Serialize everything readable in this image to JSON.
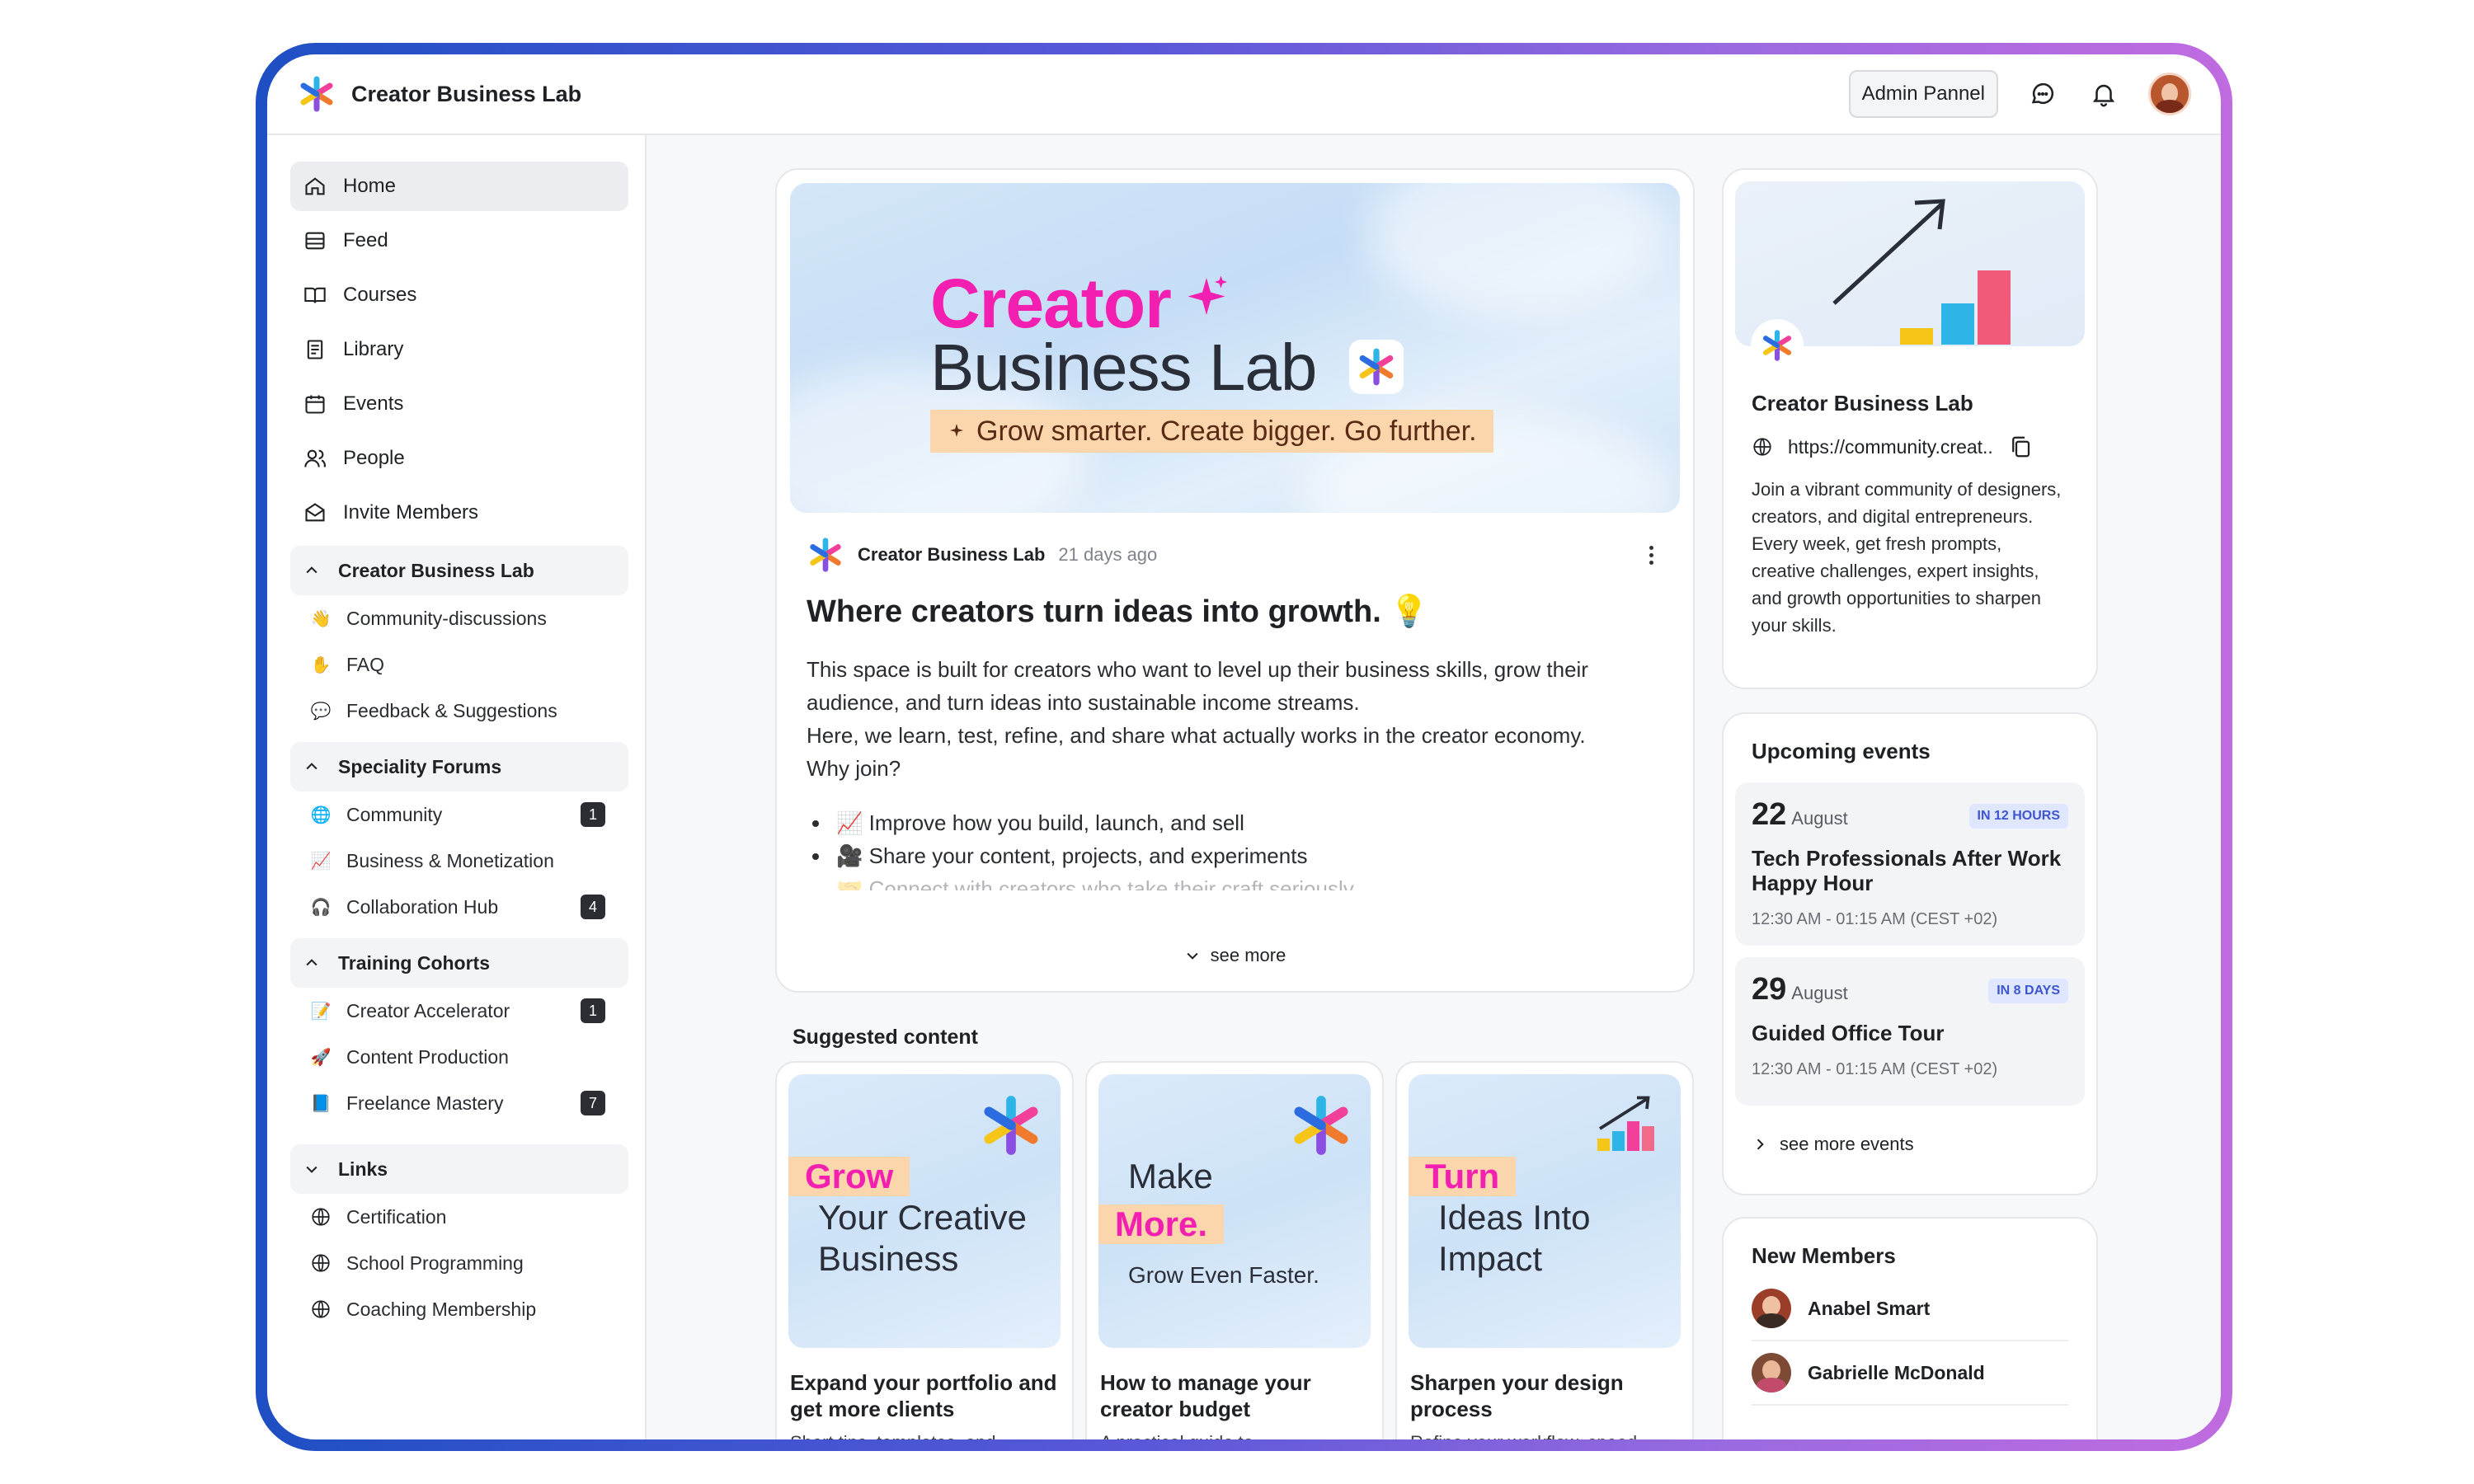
{
  "app": {
    "title": "Creator Business Lab"
  },
  "header": {
    "admin_button": "Admin Pannel"
  },
  "nav": [
    {
      "label": "Home",
      "icon": "home-icon"
    },
    {
      "label": "Feed",
      "icon": "feed-icon"
    },
    {
      "label": "Courses",
      "icon": "book-icon"
    },
    {
      "label": "Library",
      "icon": "document-icon"
    },
    {
      "label": "Events",
      "icon": "calendar-icon"
    },
    {
      "label": "People",
      "icon": "people-icon"
    },
    {
      "label": "Invite Members",
      "icon": "mail-icon"
    }
  ],
  "groups": {
    "cbl": {
      "label": "Creator Business Lab",
      "items": [
        {
          "icon": "👋",
          "label": "Community-discussions"
        },
        {
          "icon": "✋",
          "label": "FAQ"
        },
        {
          "icon": "💬",
          "label": "Feedback & Suggestions"
        }
      ]
    },
    "forums": {
      "label": "Speciality Forums",
      "items": [
        {
          "icon": "🌐",
          "label": "Community",
          "badge": "1"
        },
        {
          "icon": "📈",
          "label": "Business & Monetization"
        },
        {
          "icon": "🎧",
          "label": "Collaboration Hub",
          "badge": "4"
        }
      ]
    },
    "cohorts": {
      "label": "Training Cohorts",
      "items": [
        {
          "icon": "📝",
          "label": "Creator Accelerator",
          "badge": "1"
        },
        {
          "icon": "🚀",
          "label": "Content Production"
        },
        {
          "icon": "📘",
          "label": "Freelance Mastery",
          "badge": "7"
        }
      ]
    },
    "links": {
      "label": "Links",
      "items": [
        {
          "label": "Certification"
        },
        {
          "label": "School Programming"
        },
        {
          "label": "Coaching Membership"
        }
      ]
    }
  },
  "post": {
    "banner": {
      "title1": "Creator",
      "title2": "Business Lab",
      "tagline": "Grow smarter. Create bigger. Go further."
    },
    "author": "Creator Business Lab",
    "time": "21 days ago",
    "title": "Where creators turn ideas into growth. 💡",
    "body1": "This space is built for creators who want to level up their business skills, grow their audience, and turn ideas into sustainable income streams.",
    "body2": "Here, we learn, test, refine, and share what actually works in the creator economy.",
    "body3": "Why join?",
    "list": [
      "📈 Improve how you build, launch, and sell",
      "🎥 Share your content, projects, and experiments",
      "🤝 Connect with creators who take their craft seriously"
    ],
    "see_more": "see more"
  },
  "suggested": {
    "title": "Suggested content",
    "cards": [
      {
        "img": {
          "a": "Grow",
          "b": "Your Creative",
          "c": "Business"
        },
        "title": "Expand your portfolio and get more clients",
        "desc": "Short tips, templates, and"
      },
      {
        "img": {
          "a": "Make",
          "b": "More.",
          "c": "Grow Even Faster."
        },
        "title": "How to manage your creator budget",
        "desc": "A practical guide to"
      },
      {
        "img": {
          "a": "Turn",
          "b": "Ideas Into",
          "c": "Impact"
        },
        "title": "Sharpen your design process",
        "desc": "Refine your workflow, speed"
      }
    ]
  },
  "about": {
    "name": "Creator Business Lab",
    "url": "https://community.creat..",
    "desc": "Join a vibrant community of designers, creators, and digital entrepreneurs.\n Every week, get fresh prompts, creative challenges, expert insights, and growth opportunities to sharpen your skills."
  },
  "events": {
    "title": "Upcoming events",
    "items": [
      {
        "day": "22",
        "month": "August",
        "tag": "IN 12 HOURS",
        "title": "Tech Professionals After Work Happy Hour",
        "time": "12:30 AM - 01:15 AM (CEST +02)"
      },
      {
        "day": "29",
        "month": "August",
        "tag": "IN 8 DAYS",
        "title": "Guided Office Tour",
        "time": "12:30 AM - 01:15 AM (CEST +02)"
      }
    ],
    "see_more": "see more events"
  },
  "members": {
    "title": "New Members",
    "items": [
      {
        "name": "Anabel Smart"
      },
      {
        "name": "Gabrielle McDonald"
      }
    ]
  },
  "colors": {
    "accent_pink": "#f21fb0",
    "frame_start": "#1f4fc4",
    "frame_end": "#c06be0",
    "tag_bg": "#fbd6ac"
  }
}
